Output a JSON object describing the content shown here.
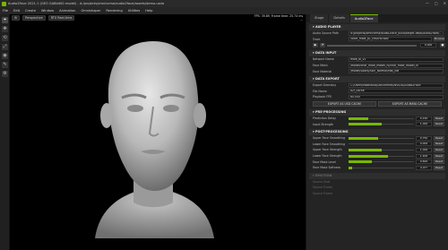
{
  "window": {
    "title": "Audio2Face 2021.1 (GEO GA8bit00 model) - d:/projects/omniverse/audio2face/assets/demo.usda",
    "controls": [
      "—",
      "▢",
      "✕"
    ]
  },
  "menu": [
    "File",
    "Edit",
    "Create",
    "Window",
    "Animation",
    "Omnishaper",
    "Rendering",
    "Utilities",
    "Help"
  ],
  "tools": [
    "⌖",
    "✥",
    "⟲",
    "⤢",
    "◉",
    "✎",
    "⚙"
  ],
  "viewport": {
    "buttons": [
      "Perspective",
      "RTX Real-time"
    ],
    "stats": [
      "FPS: 39.89, Frame time: 25.74 ms",
      "..."
    ]
  },
  "panel": {
    "tabs": [
      "Stage",
      "Details",
      "Audio2Face"
    ],
    "audio_player": {
      "title": "AUDIO PLAYER",
      "source_label": "Audio Source Path",
      "source_value": "d:/projects/omniverse/audio2face_build/target-deps/audio2face/...",
      "track_label": "Track",
      "track_value": "voice_male_p1_neutral.wav",
      "time_value": "0.000",
      "browse": "Browse"
    },
    "data_input": {
      "title": "DATA INPUT",
      "rows": [
        {
          "label": "Network Name",
          "value": "male_bl_v1"
        },
        {
          "label": "Face Mesh",
          "value": "/model/char_male_model_hi/char_male_model_hi"
        },
        {
          "label": "Face Material",
          "value": "/model/Looks/Skin_Normal/Mat_NM"
        }
      ]
    },
    "data_export": {
      "title": "DATA EXPORT",
      "rows": [
        {
          "label": "Export Directory",
          "value": "C:/Users/Moondust/Documents/NVIDIA/Audio2Face"
        },
        {
          "label": "File Name",
          "value": "a2f_cache"
        },
        {
          "label": "Playback FPS",
          "value": "60.000"
        }
      ],
      "buttons": [
        "EXPORT AS USD CACHE",
        "EXPORT AS MAYA CACHE"
      ]
    },
    "pre_processing": {
      "title": "PRE-PROCESSING",
      "rows": [
        {
          "label": "Prediction Delay",
          "value": "0.150",
          "fill": 0.3
        },
        {
          "label": "Input Strength",
          "value": "1.000",
          "fill": 0.5
        }
      ]
    },
    "post_processing": {
      "title": "POST-PROCESSING",
      "rows": [
        {
          "label": "Upper Face Smoothing",
          "value": "0.750",
          "fill": 0.45
        },
        {
          "label": "Lower Face Smoothing",
          "value": "0.000",
          "fill": 0.0
        },
        {
          "label": "Upper Face Strength",
          "value": "1.000",
          "fill": 0.5
        },
        {
          "label": "Lower Face Strength",
          "value": "1.400",
          "fill": 0.6
        },
        {
          "label": "Face Mask Level",
          "value": "0.600",
          "fill": 0.35
        },
        {
          "label": "Face Mask Softness",
          "value": "0.0??",
          "fill": 0.05
        }
      ]
    },
    "emotion": {
      "title": "EMOTION",
      "rows": [
        {
          "label": "Source Shot"
        },
        {
          "label": "Source Frame"
        },
        {
          "label": "Source Frame"
        }
      ]
    },
    "reset": "Reset"
  },
  "colors": {
    "accent": "#76b900",
    "panel": "#242424",
    "viewport": "#000000"
  }
}
